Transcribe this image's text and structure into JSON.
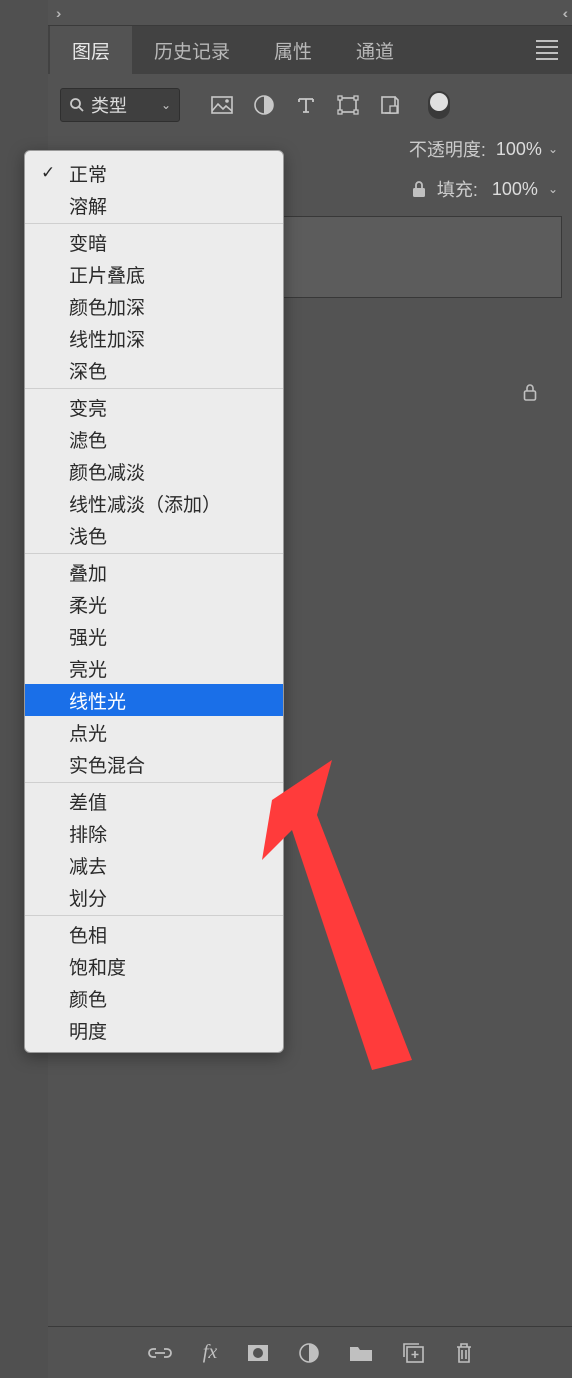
{
  "tabs": {
    "t0": "图层",
    "t1": "历史记录",
    "t2": "属性",
    "t3": "通道"
  },
  "filter": {
    "label": "类型"
  },
  "opacity": {
    "label": "不透明度:",
    "value": "100%"
  },
  "fill": {
    "label": "填充:",
    "value": "100%"
  },
  "blend": {
    "g0": {
      "i0": "正常",
      "i1": "溶解"
    },
    "g1": {
      "i0": "变暗",
      "i1": "正片叠底",
      "i2": "颜色加深",
      "i3": "线性加深",
      "i4": "深色"
    },
    "g2": {
      "i0": "变亮",
      "i1": "滤色",
      "i2": "颜色减淡",
      "i3": "线性减淡（添加）",
      "i4": "浅色"
    },
    "g3": {
      "i0": "叠加",
      "i1": "柔光",
      "i2": "强光",
      "i3": "亮光",
      "i4": "线性光",
      "i5": "点光",
      "i6": "实色混合"
    },
    "g4": {
      "i0": "差值",
      "i1": "排除",
      "i2": "减去",
      "i3": "划分"
    },
    "g5": {
      "i0": "色相",
      "i1": "饱和度",
      "i2": "颜色",
      "i3": "明度"
    }
  }
}
